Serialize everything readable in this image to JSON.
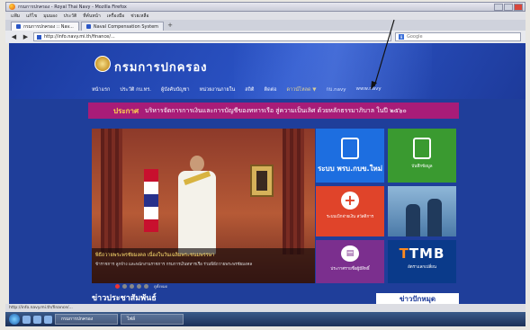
{
  "browser": {
    "title": "กรมการปกครอง - Royal Thai Navy - Mozilla Firefox",
    "menu": [
      "แฟ้ม",
      "แก้ไข",
      "มุมมอง",
      "ประวัติ",
      "ที่คั่นหน้า",
      "เครื่องมือ",
      "ช่วยเหลือ"
    ],
    "tabs": [
      {
        "label": "กรมการปกครอง :: Nav..."
      },
      {
        "label": "Naval Compensation System"
      }
    ],
    "new_tab": "+",
    "url": "http://info.navy.mi.th/finance/...",
    "search_placeholder": "Google",
    "status_url": "http://info.navy.mi.th/finance/...",
    "taskbar_items": [
      "กรมการปกครอง",
      "ไฟล์"
    ],
    "tray_time": ""
  },
  "site": {
    "logo_text": "กรมการปกครอง",
    "nav": [
      "หน้าแรก",
      "ประวัติ กบ.ทร.",
      "ผู้บังคับบัญชา",
      "หน่วยงานภายใน",
      "สถิติ",
      "ติดต่อ",
      "ดาวน์โหลด ▼",
      "กบ.navy",
      "www.navy"
    ],
    "hot_label": "ประกาศ",
    "hot_text": "บริหารจัดการการเงินและการบัญชีของทหารเรือ สู่ความเป็นเลิศ ด้วยหลักธรรมาภิบาล ในปี ๒๕๖๐",
    "slide_caption": "พิธีถวายพระพรชัยมงคล เนื่องในวันเฉลิมพระชนมพรรษา",
    "slide_desc": "ข้าราชการ ลูกจ้าง และพนักงานราชการ กรมการเงินทหารเรือ ร่วมพิธีถวายพระพรชัยมงคล",
    "slide_all": "ดูทั้งหมด",
    "tiles": [
      {
        "title": "ระบบ พรบ.กบข.ใหม่"
      },
      {
        "title": "บันทึกข้อมูล"
      },
      {
        "title": "ระบบเบิกจ่ายเงิน สวัสดิการ"
      },
      {
        "title": ""
      },
      {
        "title": "ประกาศรายชื่อผู้มีสิทธิ์"
      },
      {
        "title": "TMB",
        "sub": "อัตราแลกเปลี่ยน"
      }
    ],
    "news_heading": "ข่าวประชาสัมพันธ์",
    "news_heading2": "ข่าวปักหมุด"
  },
  "colors": {
    "header_blue": "#1f3e9a",
    "hot_bar": "#a81c78",
    "tile_blue": "#1d6ee0",
    "tile_green": "#3a9a30",
    "tile_red": "#e0442a",
    "tile_purple": "#7b2f8e",
    "tile_navy": "#0a3a8a"
  },
  "icons": [
    "firefox-icon",
    "back-arrow-icon",
    "forward-arrow-icon",
    "hand-icon",
    "plus-icon",
    "book-icon",
    "windows-start-icon"
  ]
}
